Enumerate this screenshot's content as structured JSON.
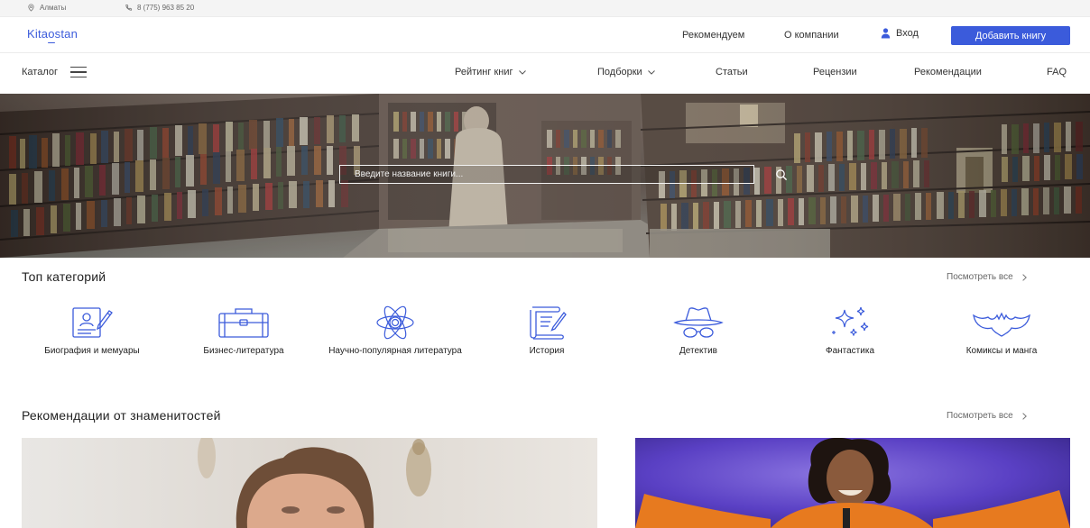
{
  "topbar": {
    "city": "Алматы",
    "phone": "8 (775) 963 85 20"
  },
  "header": {
    "logo": {
      "pre": "Kita",
      "o": "o",
      "post": "stan"
    },
    "links": [
      "Рекомендуем",
      "О компании"
    ],
    "login": "Вход",
    "add_book": "Добавить книгу"
  },
  "nav": {
    "catalog": "Каталог",
    "items": [
      "Рейтинг книг",
      "Подборки",
      "Статьи",
      "Рецензии",
      "Рекомендации",
      "FAQ"
    ]
  },
  "search": {
    "placeholder": "Введите название книги..."
  },
  "top_categories": {
    "title": "Топ категорий",
    "see_all": "Посмотреть все",
    "items": [
      {
        "label": "Биография и мемуары",
        "icon": "biography-icon"
      },
      {
        "label": "Бизнес-литература",
        "icon": "briefcase-icon"
      },
      {
        "label": "Научно-популярная литература",
        "icon": "atom-icon"
      },
      {
        "label": "История",
        "icon": "scroll-icon"
      },
      {
        "label": "Детектив",
        "icon": "detective-icon"
      },
      {
        "label": "Фантастика",
        "icon": "sparkles-icon"
      },
      {
        "label": "Комиксы и манга",
        "icon": "bat-icon"
      }
    ]
  },
  "celebrities": {
    "title": "Рекомендации от знаменитостей",
    "see_all": "Посмотреть все"
  },
  "colors": {
    "accent": "#3b5bdb",
    "icon_stroke": "#3b5bdb"
  }
}
